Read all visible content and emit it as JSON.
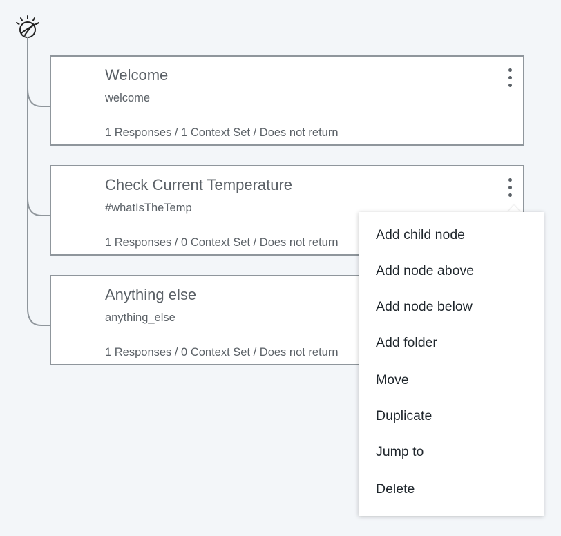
{
  "root": {
    "icon": "watson-bulb-icon"
  },
  "nodes": [
    {
      "title": "Welcome",
      "condition": "welcome",
      "summary": "1 Responses / 1 Context Set / Does not return"
    },
    {
      "title": "Check Current Temperature",
      "condition": "#whatIsTheTemp",
      "summary": "1 Responses / 0 Context Set / Does not return"
    },
    {
      "title": "Anything else",
      "condition": "anything_else",
      "summary": "1 Responses / 0 Context Set / Does not return"
    }
  ],
  "context_menu": {
    "items": [
      {
        "label": "Add child node"
      },
      {
        "label": "Add node above"
      },
      {
        "label": "Add node below"
      },
      {
        "label": "Add folder"
      },
      {
        "label": "Move"
      },
      {
        "label": "Duplicate"
      },
      {
        "label": "Jump to"
      },
      {
        "label": "Delete"
      }
    ]
  },
  "colors": {
    "background": "#f3f6f9",
    "node_border": "#8f969c",
    "text": "#5b6167",
    "menu_text": "#1f262c"
  }
}
